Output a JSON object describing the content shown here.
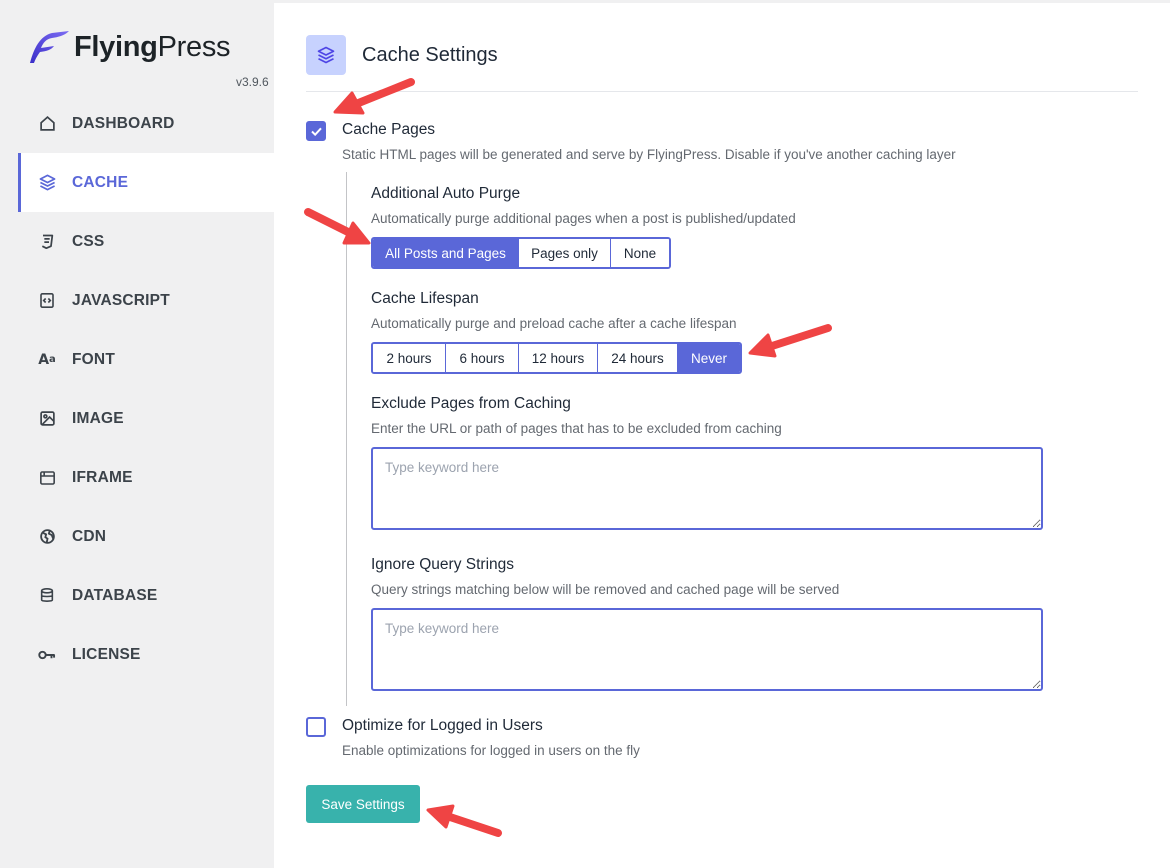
{
  "brand": {
    "name_bold": "Flying",
    "name_regular": "Press",
    "version": "v3.9.6"
  },
  "sidebar": {
    "items": [
      {
        "label": "DASHBOARD",
        "icon": "home-icon"
      },
      {
        "label": "CACHE",
        "icon": "layers-icon",
        "active": true
      },
      {
        "label": "CSS",
        "icon": "css3-icon"
      },
      {
        "label": "JAVASCRIPT",
        "icon": "code-file-icon"
      },
      {
        "label": "FONT",
        "icon": "font-icon"
      },
      {
        "label": "IMAGE",
        "icon": "image-icon"
      },
      {
        "label": "IFRAME",
        "icon": "window-icon"
      },
      {
        "label": "CDN",
        "icon": "globe-icon"
      },
      {
        "label": "DATABASE",
        "icon": "database-icon"
      },
      {
        "label": "LICENSE",
        "icon": "key-icon"
      }
    ]
  },
  "header": {
    "title": "Cache Settings",
    "icon": "layers-icon"
  },
  "cache_pages": {
    "label": "Cache Pages",
    "checked": true,
    "description": "Static HTML pages will be generated and serve by FlyingPress. Disable if you've another caching layer"
  },
  "auto_purge": {
    "title": "Additional Auto Purge",
    "description": "Automatically purge additional pages when a post is published/updated",
    "options": [
      "All Posts and Pages",
      "Pages only",
      "None"
    ],
    "selected": "All Posts and Pages"
  },
  "lifespan": {
    "title": "Cache Lifespan",
    "description": "Automatically purge and preload cache after a cache lifespan",
    "options": [
      "2 hours",
      "6 hours",
      "12 hours",
      "24 hours",
      "Never"
    ],
    "selected": "Never"
  },
  "exclude_pages": {
    "title": "Exclude Pages from Caching",
    "description": "Enter the URL or path of pages that has to be excluded from caching",
    "placeholder": "Type keyword here",
    "value": ""
  },
  "ignore_query": {
    "title": "Ignore Query Strings",
    "description": "Query strings matching below will be removed and cached page will be served",
    "placeholder": "Type keyword here",
    "value": ""
  },
  "logged_in": {
    "label": "Optimize for Logged in Users",
    "checked": false,
    "description": "Enable optimizations for logged in users on the fly"
  },
  "save_button": {
    "label": "Save Settings"
  },
  "colors": {
    "accent": "#5a67d8",
    "save": "#38b2ac",
    "annotation_arrow": "#ef4444",
    "sidebar_bg": "#f0f0f1"
  }
}
